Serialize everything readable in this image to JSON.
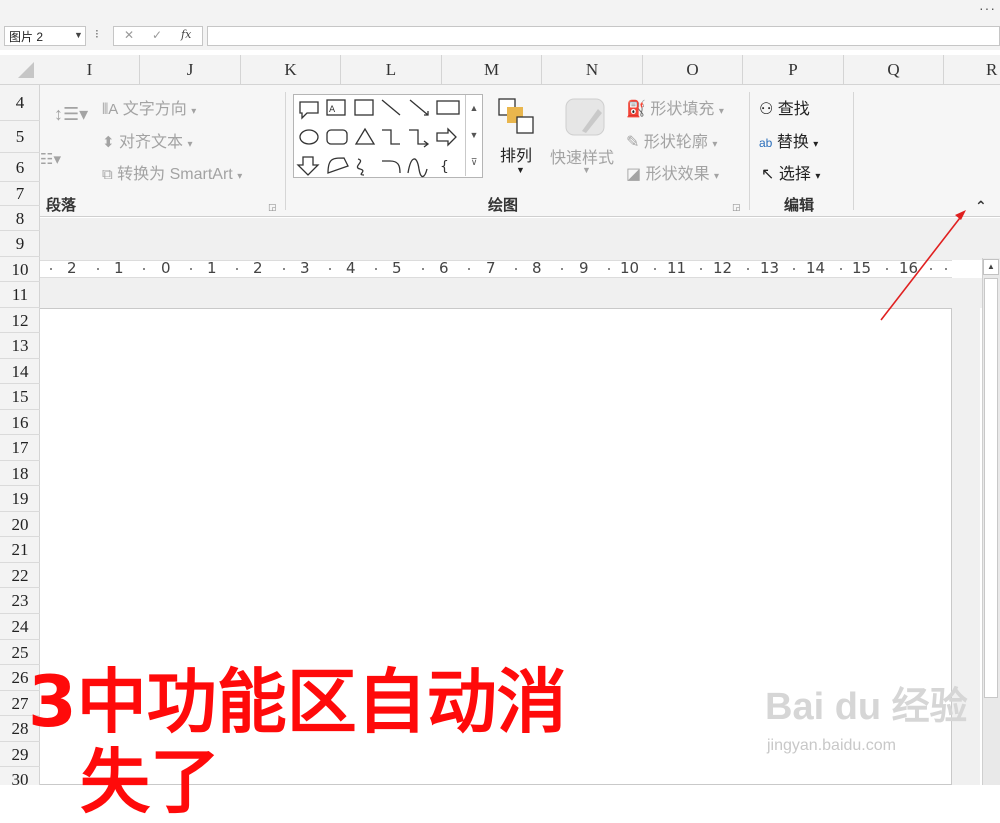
{
  "window": {
    "more_label": "···"
  },
  "formula_bar": {
    "name_box": "图片 2",
    "separator": "⁝",
    "cancel": "✕",
    "enter": "✓",
    "fx": "fx",
    "value": ""
  },
  "columns": [
    "I",
    "J",
    "K",
    "L",
    "M",
    "N",
    "O",
    "P",
    "Q",
    "R"
  ],
  "rows": [
    "4",
    "5",
    "6",
    "7",
    "8",
    "9",
    "10",
    "11",
    "12",
    "13",
    "14",
    "15",
    "16",
    "17",
    "18",
    "19",
    "20",
    "21",
    "22",
    "23",
    "24",
    "25",
    "26",
    "27",
    "28",
    "29",
    "30"
  ],
  "ribbon": {
    "paragraph": {
      "text_direction": "文字方向",
      "align_text": "对齐文本",
      "convert_smartart": "转换为 SmartArt",
      "label": "段落"
    },
    "drawing": {
      "arrange": "排列",
      "quick_styles": "快速样式",
      "shape_fill": "形状填充",
      "shape_outline": "形状轮廓",
      "shape_effects": "形状效果",
      "label": "绘图"
    },
    "editing": {
      "find": "查找",
      "replace": "替换",
      "select": "选择",
      "label": "编辑"
    }
  },
  "ruler": {
    "numbers": [
      "2",
      "1",
      "0",
      "1",
      "2",
      "3",
      "4",
      "5",
      "6",
      "7",
      "8",
      "9",
      "10",
      "11",
      "12",
      "13",
      "14",
      "15",
      "16"
    ]
  },
  "overlay": {
    "line1": "3中功能区自动消",
    "line2": "失了"
  },
  "watermark": {
    "brand": "Bai du 经验",
    "url": "jingyan.baidu.com"
  },
  "colors": {
    "overlay_red": "#ff0a0a",
    "arrow_red": "#e02020",
    "ribbon_bg": "#f6f6f6"
  }
}
